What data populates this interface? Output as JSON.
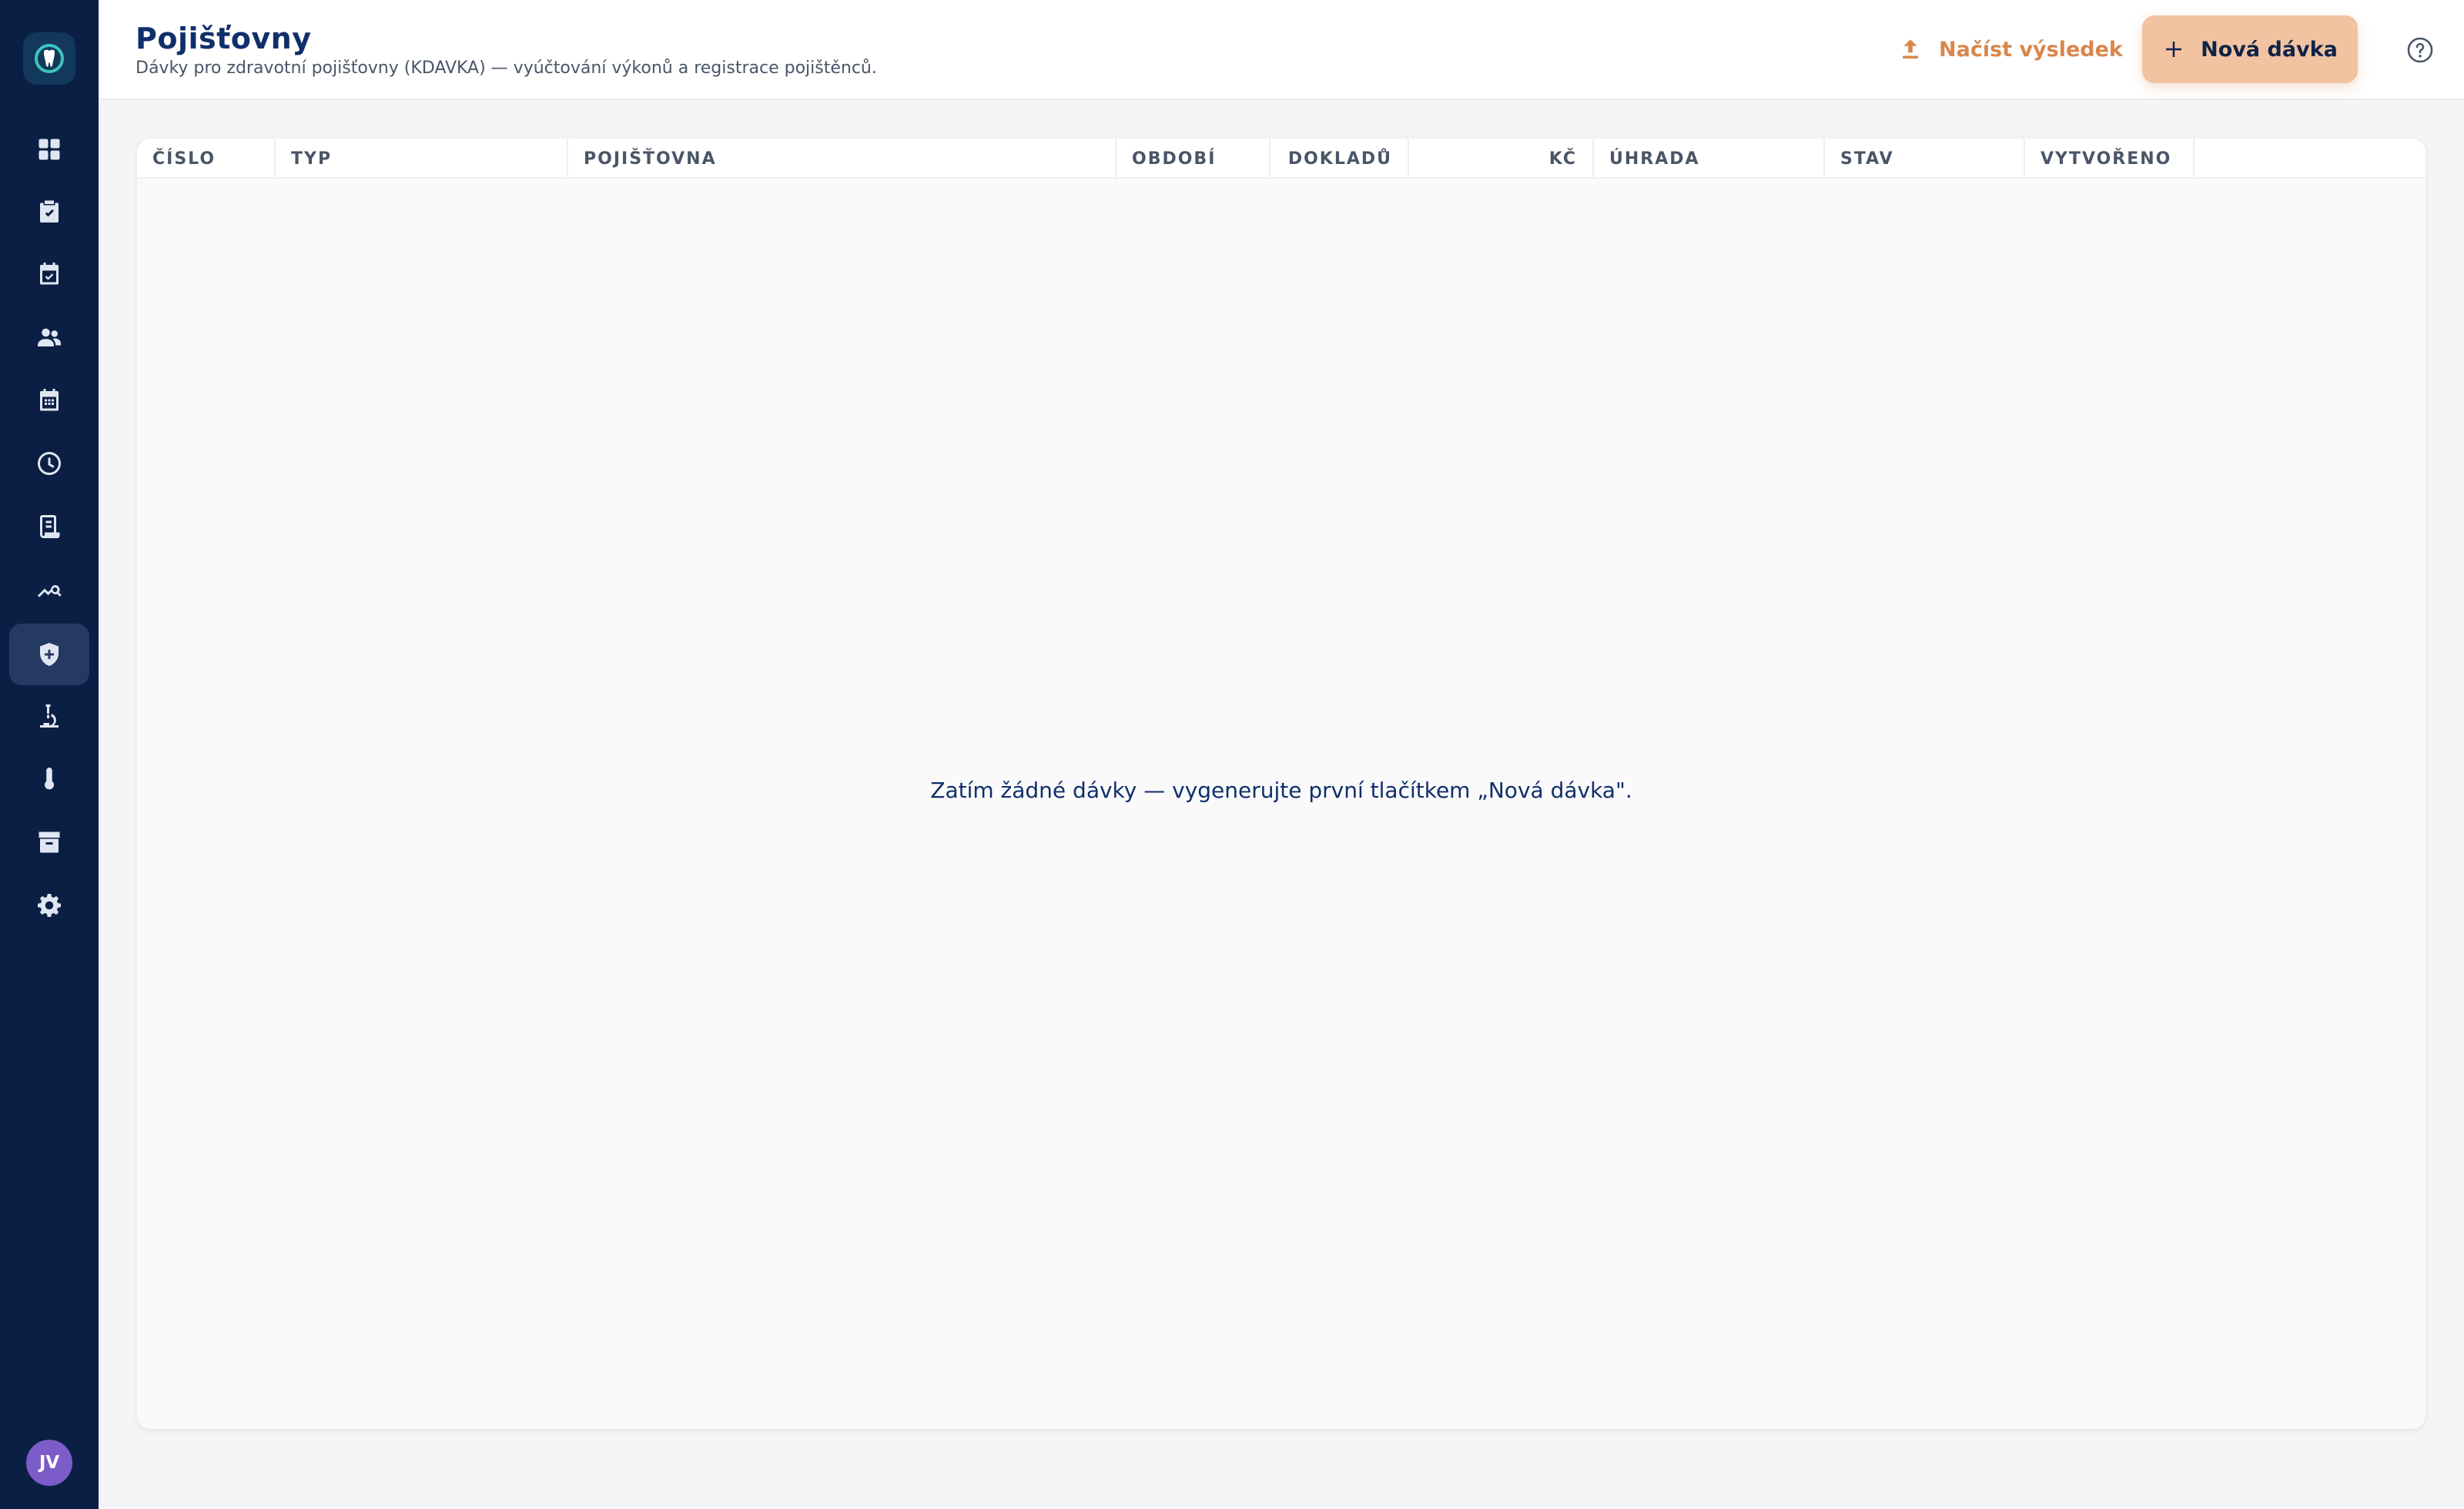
{
  "sidebar": {
    "avatar_initials": "JV",
    "items": [
      {
        "icon": "dashboard-icon"
      },
      {
        "icon": "clipboard-check-icon"
      },
      {
        "icon": "calendar-check-icon"
      },
      {
        "icon": "people-icon"
      },
      {
        "icon": "calendar-icon"
      },
      {
        "icon": "clock-icon"
      },
      {
        "icon": "receipt-icon"
      },
      {
        "icon": "analytics-search-icon"
      },
      {
        "icon": "shield-plus-icon",
        "active": true
      },
      {
        "icon": "microscope-icon"
      },
      {
        "icon": "thermometer-icon"
      },
      {
        "icon": "archive-icon"
      },
      {
        "icon": "gear-icon"
      }
    ]
  },
  "header": {
    "title": "Pojišťovny",
    "subtitle": "Dávky pro zdravotní pojišťovny (KDAVKA) — vyúčtování výkonů a registrace pojištěnců.",
    "load_label": "Načíst výsledek",
    "new_label": "Nová dávka"
  },
  "table": {
    "columns": [
      "ČÍSLO",
      "TYP",
      "POJIŠŤOVNA",
      "OBDOBÍ",
      "DOKLADŮ",
      "KČ",
      "ÚHRADA",
      "STAV",
      "VYTVOŘENO"
    ],
    "rows": [],
    "empty_message": "Zatím žádné dávky — vygenerujte první tlačítkem „Nová dávka\"."
  },
  "colors": {
    "sidebar_bg": "#0b1f44",
    "accent": "#d8864c",
    "primary_button_bg": "#f2c3a1",
    "title": "#0f2f6b"
  }
}
